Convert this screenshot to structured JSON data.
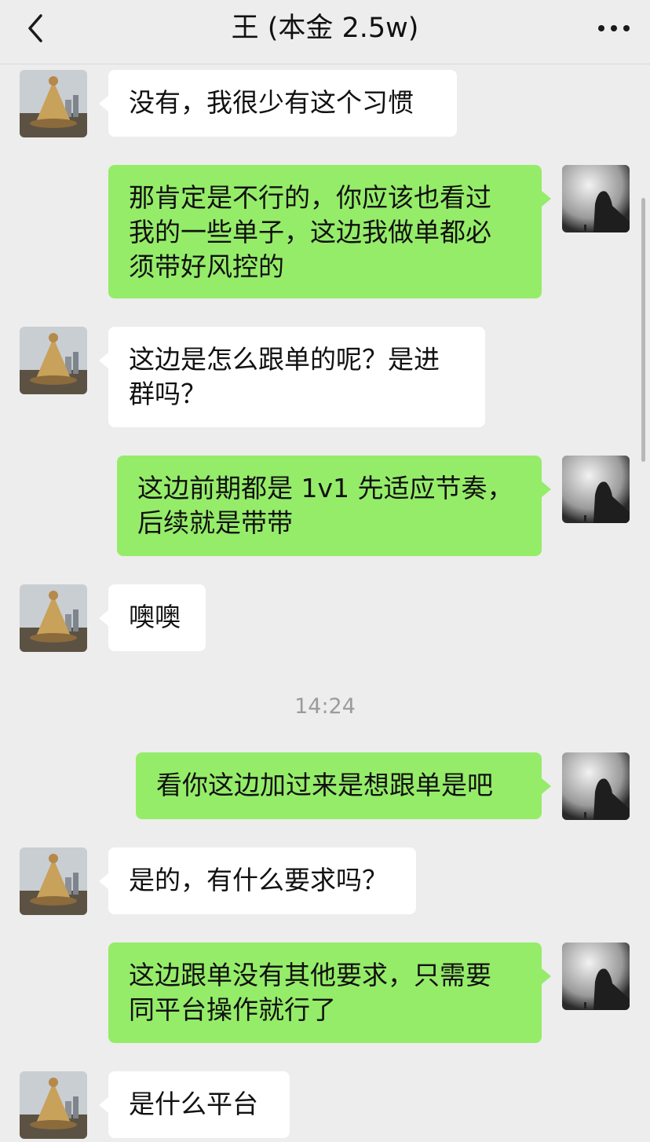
{
  "header": {
    "title": "王 (本金 2.5w)",
    "back_icon": "chevron-left-icon",
    "more_icon": "more-horizontal-icon"
  },
  "messages": [
    {
      "side": "them",
      "text": "没有，我很少有这个习惯"
    },
    {
      "side": "me",
      "text": "那肯定是不行的，你应该也看过\n我的一些单子，这边我做单都必\n须带好风控的"
    },
    {
      "side": "them",
      "text": "这边是怎么跟单的呢？是进\n群吗？"
    },
    {
      "side": "me",
      "text": "这边前期都是 1v1 先适应节奏，\n后续就是带带"
    },
    {
      "side": "them",
      "text": "噢噢"
    },
    {
      "side": "me",
      "text": "看你这边加过来是想跟单是吧"
    },
    {
      "side": "them",
      "text": "是的，有什么要求吗？"
    },
    {
      "side": "me",
      "text": "这边跟单没有其他要求，只需要\n同平台操作就行了"
    },
    {
      "side": "them",
      "text": "是什么平台"
    }
  ],
  "timestamp": "14:24",
  "colors": {
    "background": "#ededed",
    "bubble_me": "#95ec69",
    "bubble_them": "#ffffff"
  }
}
